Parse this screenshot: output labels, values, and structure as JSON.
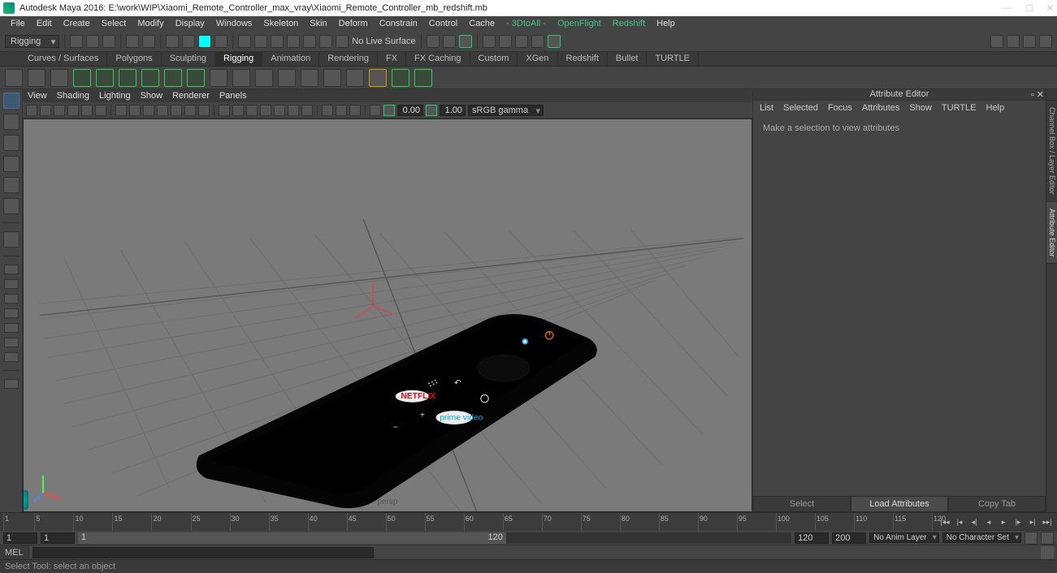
{
  "window": {
    "title": "Autodesk Maya 2016: E:\\work\\WIP\\Xiaomi_Remote_Controller_max_vray\\Xiaomi_Remote_Controller_mb_redshift.mb"
  },
  "menubar": [
    "File",
    "Edit",
    "Create",
    "Select",
    "Modify",
    "Display",
    "Windows",
    "Skeleton",
    "Skin",
    "Deform",
    "Constrain",
    "Control",
    "Cache"
  ],
  "menubar_plugins": [
    "- 3DtoAll -",
    "OpenFlight",
    "Redshift",
    "Help"
  ],
  "statusrow": {
    "mode": "Rigging",
    "nls": "No Live Surface"
  },
  "shelftabs": [
    "Curves / Surfaces",
    "Polygons",
    "Sculpting",
    "Rigging",
    "Animation",
    "Rendering",
    "FX",
    "FX Caching",
    "Custom",
    "XGen",
    "Redshift",
    "Bullet",
    "TURTLE"
  ],
  "shelftab_active": "Rigging",
  "panelmenu": [
    "View",
    "Shading",
    "Lighting",
    "Show",
    "Renderer",
    "Panels"
  ],
  "paneltb": {
    "gamma1": "0.00",
    "gamma2": "1.00",
    "colorspace": "sRGB gamma"
  },
  "viewport": {
    "camera": "persp"
  },
  "ae": {
    "title": "Attribute Editor",
    "menus": [
      "List",
      "Selected",
      "Focus",
      "Attributes",
      "Show",
      "TURTLE",
      "Help"
    ],
    "empty": "Make a selection to view attributes",
    "buttons": [
      "Select",
      "Load Attributes",
      "Copy Tab"
    ]
  },
  "sidetabs": [
    "Channel Box / Layer Editor",
    "Attribute Editor"
  ],
  "timeslider": {
    "ticks": [
      1,
      5,
      10,
      15,
      20,
      25,
      30,
      35,
      40,
      45,
      50,
      55,
      60,
      65,
      70,
      75,
      80,
      85,
      90,
      95,
      100,
      105,
      110,
      115,
      120
    ]
  },
  "range": {
    "start_outer": "1",
    "start_inner": "1",
    "end_inner": "120",
    "end_outer": "120",
    "end_range": "200",
    "anim_layer": "No Anim Layer",
    "char_set": "No Character Set",
    "handle_label_left": "1",
    "handle_label_right": "120"
  },
  "cmd": {
    "lang": "MEL"
  },
  "help": "Select Tool: select an object"
}
